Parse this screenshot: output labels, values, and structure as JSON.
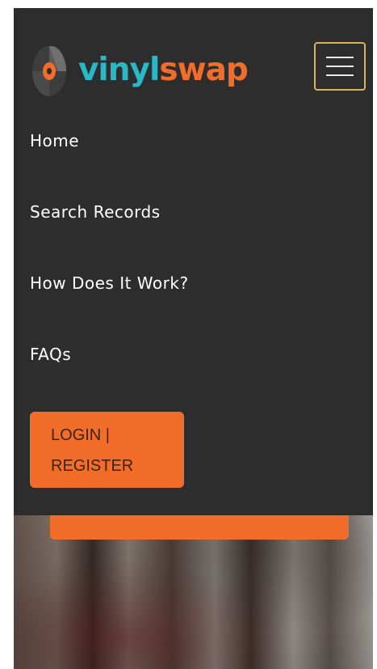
{
  "brand": {
    "part1": "vinyl",
    "part2": "swap",
    "colors": {
      "teal": "#2ab7c6",
      "orange": "#f26d2a"
    },
    "logo_icon": "vinyl-record-icon"
  },
  "menu_toggle": {
    "icon": "hamburger-menu-icon",
    "border_color": "#d9b25c"
  },
  "nav": {
    "items": [
      {
        "label": "Home"
      },
      {
        "label": "Search Records"
      },
      {
        "label": "How Does It Work?"
      },
      {
        "label": "FAQs"
      }
    ]
  },
  "auth": {
    "login_label": "LOGIN |",
    "register_label": "REGISTER"
  },
  "theme": {
    "navbar_bg": "#2d2d2d",
    "accent": "#f26d2a"
  }
}
